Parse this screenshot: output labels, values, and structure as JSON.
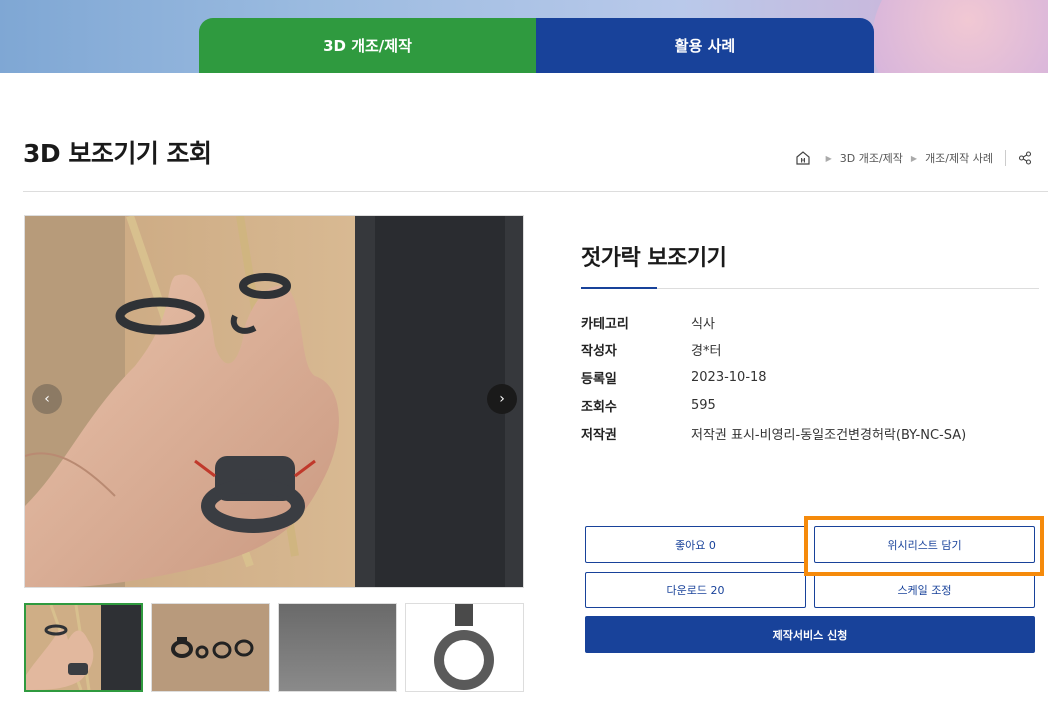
{
  "top_tabs": [
    {
      "label": "3D 개조/제작",
      "color": "#2f9a3f",
      "active": true
    },
    {
      "label": "활용 사례",
      "color": "#18429a",
      "active": false
    }
  ],
  "page_title": "3D 보조기기 조회",
  "breadcrumb": {
    "home_icon": "home-icon",
    "items": [
      "3D 개조/제작",
      "개조/제작 사례"
    ],
    "share_icon": "share-icon"
  },
  "carousel": {
    "prev_icon": "chevron-left-icon",
    "next_icon": "chevron-right-icon",
    "thumbnail_count": 4,
    "active_thumbnail": 0
  },
  "product": {
    "title": "젓가락 보조기기",
    "info": [
      {
        "label": "카테고리",
        "value": "식사"
      },
      {
        "label": "작성자",
        "value": "경*터"
      },
      {
        "label": "등록일",
        "value": "2023-10-18"
      },
      {
        "label": "조회수",
        "value": "595"
      },
      {
        "label": "저작권",
        "value": "저작권 표시-비영리-동일조건변경허락(BY-NC-SA)"
      }
    ]
  },
  "actions": {
    "like": "좋아요 0",
    "wishlist": "위시리스트 담기",
    "download": "다운로드 20",
    "scale": "스케일 조정",
    "request": "제작서비스 신청"
  },
  "colors": {
    "green": "#2f9a3f",
    "navy": "#18429a",
    "highlight": "#f58a0b"
  }
}
